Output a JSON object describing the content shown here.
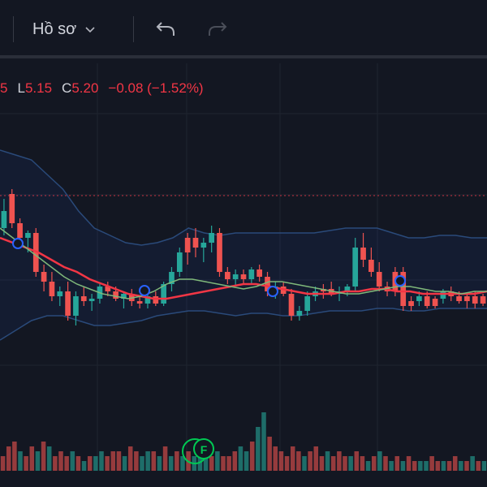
{
  "toolbar": {
    "layout_label": "Hồ sơ",
    "chevron_icon": "chevron-down-icon",
    "undo_icon": "undo-icon",
    "redo_icon": "redo-icon"
  },
  "legend": {
    "prev_close_fragment": "5",
    "low_key": "L",
    "low_value": "5.15",
    "close_key": "C",
    "close_value": "5.20",
    "change": "−0.08 (−1.52%)"
  },
  "colors": {
    "background": "#131722",
    "up": "#26a69a",
    "down": "#ef5350",
    "ma_red": "#f23645",
    "ma_green": "#7fb87a",
    "band": "#2962ff",
    "marker": "#2962ff",
    "earnings_badge": "#00c853"
  },
  "earnings_badge_letter": "F",
  "chart_data": {
    "type": "candlestick",
    "price_level_line": "dashed red line at last price",
    "candles": [
      {
        "o": 5.55,
        "h": 5.6,
        "l": 5.45,
        "c": 5.48,
        "dir": "up"
      },
      {
        "o": 5.62,
        "h": 5.64,
        "l": 5.48,
        "c": 5.5,
        "dir": "down"
      },
      {
        "o": 5.5,
        "h": 5.52,
        "l": 5.42,
        "c": 5.44,
        "dir": "down"
      },
      {
        "o": 5.44,
        "h": 5.47,
        "l": 5.38,
        "c": 5.46,
        "dir": "up"
      },
      {
        "o": 5.46,
        "h": 5.48,
        "l": 5.28,
        "c": 5.3,
        "dir": "down"
      },
      {
        "o": 5.3,
        "h": 5.33,
        "l": 5.22,
        "c": 5.26,
        "dir": "down"
      },
      {
        "o": 5.26,
        "h": 5.3,
        "l": 5.18,
        "c": 5.2,
        "dir": "down"
      },
      {
        "o": 5.2,
        "h": 5.24,
        "l": 5.16,
        "c": 5.22,
        "dir": "up"
      },
      {
        "o": 5.22,
        "h": 5.26,
        "l": 5.1,
        "c": 5.12,
        "dir": "down"
      },
      {
        "o": 5.12,
        "h": 5.22,
        "l": 5.08,
        "c": 5.2,
        "dir": "up"
      },
      {
        "o": 5.2,
        "h": 5.24,
        "l": 5.16,
        "c": 5.18,
        "dir": "down"
      },
      {
        "o": 5.18,
        "h": 5.21,
        "l": 5.14,
        "c": 5.19,
        "dir": "up"
      },
      {
        "o": 5.19,
        "h": 5.25,
        "l": 5.17,
        "c": 5.24,
        "dir": "up"
      },
      {
        "o": 5.24,
        "h": 5.26,
        "l": 5.2,
        "c": 5.22,
        "dir": "down"
      },
      {
        "o": 5.22,
        "h": 5.24,
        "l": 5.18,
        "c": 5.19,
        "dir": "down"
      },
      {
        "o": 5.19,
        "h": 5.22,
        "l": 5.15,
        "c": 5.21,
        "dir": "up"
      },
      {
        "o": 5.21,
        "h": 5.23,
        "l": 5.16,
        "c": 5.18,
        "dir": "down"
      },
      {
        "o": 5.18,
        "h": 5.2,
        "l": 5.15,
        "c": 5.17,
        "dir": "down"
      },
      {
        "o": 5.17,
        "h": 5.21,
        "l": 5.15,
        "c": 5.2,
        "dir": "up"
      },
      {
        "o": 5.2,
        "h": 5.22,
        "l": 5.16,
        "c": 5.17,
        "dir": "down"
      },
      {
        "o": 5.17,
        "h": 5.26,
        "l": 5.16,
        "c": 5.25,
        "dir": "up"
      },
      {
        "o": 5.25,
        "h": 5.32,
        "l": 5.22,
        "c": 5.3,
        "dir": "up"
      },
      {
        "o": 5.3,
        "h": 5.4,
        "l": 5.28,
        "c": 5.38,
        "dir": "up"
      },
      {
        "o": 5.38,
        "h": 5.46,
        "l": 5.33,
        "c": 5.44,
        "dir": "down"
      },
      {
        "o": 5.44,
        "h": 5.48,
        "l": 5.36,
        "c": 5.4,
        "dir": "down"
      },
      {
        "o": 5.4,
        "h": 5.44,
        "l": 5.34,
        "c": 5.42,
        "dir": "up"
      },
      {
        "o": 5.42,
        "h": 5.49,
        "l": 5.38,
        "c": 5.46,
        "dir": "up"
      },
      {
        "o": 5.46,
        "h": 5.48,
        "l": 5.28,
        "c": 5.3,
        "dir": "down"
      },
      {
        "o": 5.3,
        "h": 5.32,
        "l": 5.25,
        "c": 5.27,
        "dir": "down"
      },
      {
        "o": 5.27,
        "h": 5.31,
        "l": 5.24,
        "c": 5.29,
        "dir": "up"
      },
      {
        "o": 5.29,
        "h": 5.31,
        "l": 5.25,
        "c": 5.27,
        "dir": "down"
      },
      {
        "o": 5.27,
        "h": 5.32,
        "l": 5.25,
        "c": 5.31,
        "dir": "up"
      },
      {
        "o": 5.31,
        "h": 5.33,
        "l": 5.26,
        "c": 5.28,
        "dir": "down"
      },
      {
        "o": 5.28,
        "h": 5.3,
        "l": 5.2,
        "c": 5.22,
        "dir": "down"
      },
      {
        "o": 5.22,
        "h": 5.26,
        "l": 5.19,
        "c": 5.24,
        "dir": "up"
      },
      {
        "o": 5.24,
        "h": 5.26,
        "l": 5.2,
        "c": 5.21,
        "dir": "down"
      },
      {
        "o": 5.21,
        "h": 5.23,
        "l": 5.1,
        "c": 5.12,
        "dir": "down"
      },
      {
        "o": 5.12,
        "h": 5.16,
        "l": 5.1,
        "c": 5.14,
        "dir": "up"
      },
      {
        "o": 5.14,
        "h": 5.22,
        "l": 5.12,
        "c": 5.2,
        "dir": "up"
      },
      {
        "o": 5.2,
        "h": 5.24,
        "l": 5.18,
        "c": 5.22,
        "dir": "up"
      },
      {
        "o": 5.22,
        "h": 5.25,
        "l": 5.19,
        "c": 5.23,
        "dir": "down"
      },
      {
        "o": 5.23,
        "h": 5.26,
        "l": 5.2,
        "c": 5.21,
        "dir": "down"
      },
      {
        "o": 5.21,
        "h": 5.24,
        "l": 5.18,
        "c": 5.22,
        "dir": "up"
      },
      {
        "o": 5.22,
        "h": 5.25,
        "l": 5.2,
        "c": 5.24,
        "dir": "up"
      },
      {
        "o": 5.24,
        "h": 5.44,
        "l": 5.22,
        "c": 5.4,
        "dir": "up"
      },
      {
        "o": 5.4,
        "h": 5.46,
        "l": 5.32,
        "c": 5.35,
        "dir": "down"
      },
      {
        "o": 5.35,
        "h": 5.4,
        "l": 5.28,
        "c": 5.3,
        "dir": "down"
      },
      {
        "o": 5.3,
        "h": 5.34,
        "l": 5.22,
        "c": 5.24,
        "dir": "down"
      },
      {
        "o": 5.24,
        "h": 5.26,
        "l": 5.2,
        "c": 5.22,
        "dir": "down"
      },
      {
        "o": 5.22,
        "h": 5.32,
        "l": 5.2,
        "c": 5.3,
        "dir": "down"
      },
      {
        "o": 5.3,
        "h": 5.32,
        "l": 5.14,
        "c": 5.16,
        "dir": "down"
      },
      {
        "o": 5.16,
        "h": 5.2,
        "l": 5.14,
        "c": 5.18,
        "dir": "down"
      },
      {
        "o": 5.18,
        "h": 5.22,
        "l": 5.16,
        "c": 5.2,
        "dir": "up"
      },
      {
        "o": 5.2,
        "h": 5.22,
        "l": 5.15,
        "c": 5.16,
        "dir": "down"
      },
      {
        "o": 5.16,
        "h": 5.2,
        "l": 5.15,
        "c": 5.19,
        "dir": "down"
      },
      {
        "o": 5.19,
        "h": 5.23,
        "l": 5.17,
        "c": 5.22,
        "dir": "up"
      },
      {
        "o": 5.22,
        "h": 5.24,
        "l": 5.18,
        "c": 5.2,
        "dir": "down"
      },
      {
        "o": 5.2,
        "h": 5.22,
        "l": 5.17,
        "c": 5.18,
        "dir": "down"
      },
      {
        "o": 5.18,
        "h": 5.21,
        "l": 5.15,
        "c": 5.2,
        "dir": "down"
      },
      {
        "o": 5.2,
        "h": 5.22,
        "l": 5.15,
        "c": 5.17,
        "dir": "down"
      },
      {
        "o": 5.17,
        "h": 5.21,
        "l": 5.16,
        "c": 5.2,
        "dir": "down"
      }
    ],
    "volume": [
      3,
      5,
      6,
      4,
      3,
      5,
      4,
      6,
      5,
      3,
      4,
      3,
      4,
      3,
      2,
      3,
      3,
      4,
      3,
      4,
      4,
      3,
      5,
      4,
      3,
      4,
      4,
      3,
      5,
      3,
      4,
      3,
      4,
      3,
      5,
      4,
      3,
      4,
      3,
      3,
      4,
      5,
      4,
      6,
      9,
      12,
      7,
      5,
      4,
      3,
      5,
      4,
      3,
      4,
      5,
      3,
      4,
      3,
      4,
      3,
      3,
      4,
      3,
      2,
      3,
      4,
      3,
      2,
      3,
      2,
      3,
      2,
      2,
      2,
      3,
      2,
      2,
      2,
      3,
      2,
      2,
      3,
      2,
      2
    ],
    "volume_dir": [
      "d",
      "d",
      "d",
      "u",
      "d",
      "d",
      "u",
      "d",
      "u",
      "d",
      "d",
      "d",
      "u",
      "d",
      "u",
      "d",
      "u",
      "u",
      "d",
      "d",
      "d",
      "u",
      "d",
      "d",
      "u",
      "u",
      "d",
      "u",
      "d",
      "u",
      "d",
      "u",
      "d",
      "u",
      "u",
      "u",
      "d",
      "u",
      "d",
      "d",
      "d",
      "u",
      "u",
      "d",
      "u",
      "u",
      "d",
      "d",
      "d",
      "d",
      "d",
      "d",
      "u",
      "d",
      "d",
      "d",
      "u",
      "d",
      "d",
      "d",
      "u",
      "d",
      "d",
      "u",
      "d",
      "u",
      "d",
      "u",
      "d",
      "u",
      "d",
      "d",
      "u",
      "u",
      "d",
      "d",
      "u",
      "d",
      "d",
      "u",
      "d",
      "u",
      "d",
      "u"
    ],
    "ma_red": [
      5.44,
      5.42,
      5.4,
      5.38,
      5.35,
      5.32,
      5.3,
      5.27,
      5.25,
      5.23,
      5.21,
      5.2,
      5.19,
      5.19,
      5.2,
      5.21,
      5.22,
      5.23,
      5.24,
      5.25,
      5.25,
      5.24,
      5.23,
      5.22,
      5.21,
      5.21,
      5.21,
      5.22,
      5.22,
      5.23,
      5.23,
      5.22,
      5.22,
      5.21,
      5.21,
      5.21,
      5.21,
      5.21,
      5.22
    ],
    "ma_green": [
      5.48,
      5.44,
      5.4,
      5.36,
      5.32,
      5.28,
      5.25,
      5.23,
      5.21,
      5.2,
      5.19,
      5.2,
      5.22,
      5.25,
      5.27,
      5.27,
      5.26,
      5.25,
      5.24,
      5.23,
      5.24,
      5.26,
      5.26,
      5.25,
      5.24,
      5.23,
      5.22,
      5.21,
      5.21,
      5.22,
      5.23,
      5.24,
      5.24,
      5.23,
      5.22,
      5.22,
      5.21,
      5.22,
      5.22
    ],
    "band_upper": [
      5.8,
      5.78,
      5.76,
      5.7,
      5.64,
      5.55,
      5.48,
      5.45,
      5.42,
      5.41,
      5.42,
      5.44,
      5.48,
      5.46,
      5.45,
      5.46,
      5.46,
      5.46,
      5.46,
      5.46,
      5.46,
      5.47,
      5.48,
      5.48,
      5.48,
      5.46,
      5.44,
      5.44,
      5.45,
      5.45,
      5.44,
      5.44
    ],
    "band_lower": [
      5.02,
      5.06,
      5.1,
      5.12,
      5.12,
      5.1,
      5.08,
      5.08,
      5.09,
      5.1,
      5.12,
      5.13,
      5.14,
      5.14,
      5.13,
      5.12,
      5.13,
      5.13,
      5.12,
      5.12,
      5.13,
      5.14,
      5.14,
      5.14,
      5.15,
      5.15,
      5.14,
      5.14,
      5.15,
      5.15,
      5.15,
      5.15
    ],
    "last_price": 5.63,
    "markers_ma_cross": 4
  }
}
